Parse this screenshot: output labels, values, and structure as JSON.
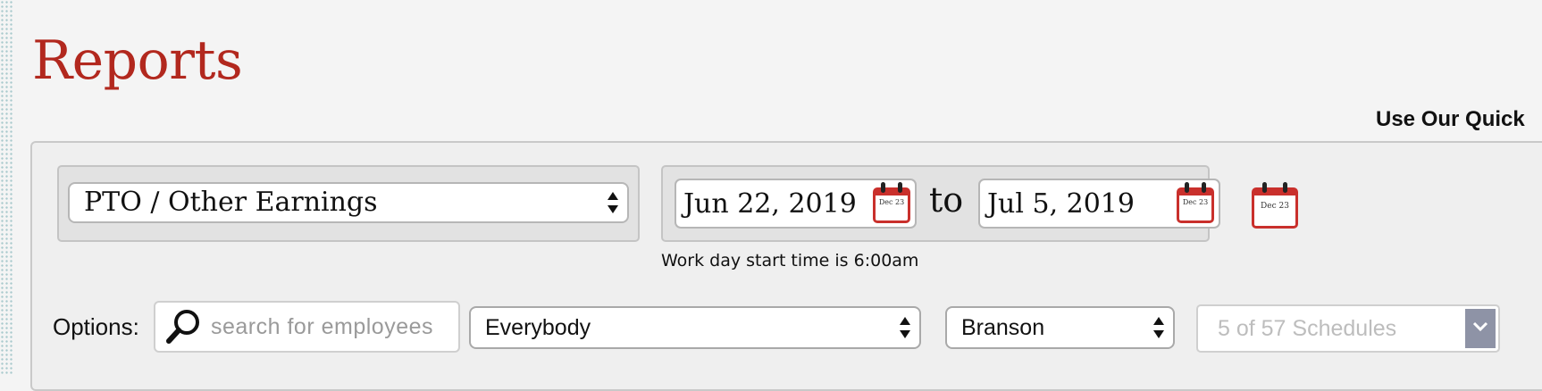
{
  "page": {
    "title": "Reports"
  },
  "header": {
    "quick_link": "Use Our Quick"
  },
  "report": {
    "selected": "PTO / Other Earnings"
  },
  "date_range": {
    "start": "Jun 22, 2019",
    "separator": "to",
    "end": "Jul 5, 2019",
    "calendar_icon_text": "Dec 23",
    "note": "Work day start time is 6:00am"
  },
  "options": {
    "label": "Options:",
    "search_placeholder": "search for employees",
    "employee_filter": "Everybody",
    "location": "Branson",
    "schedules": "5 of 57 Schedules"
  },
  "colors": {
    "title_red": "#b2281e",
    "calendar_red": "#c9302c",
    "dropdown_button": "#8e93a6"
  }
}
